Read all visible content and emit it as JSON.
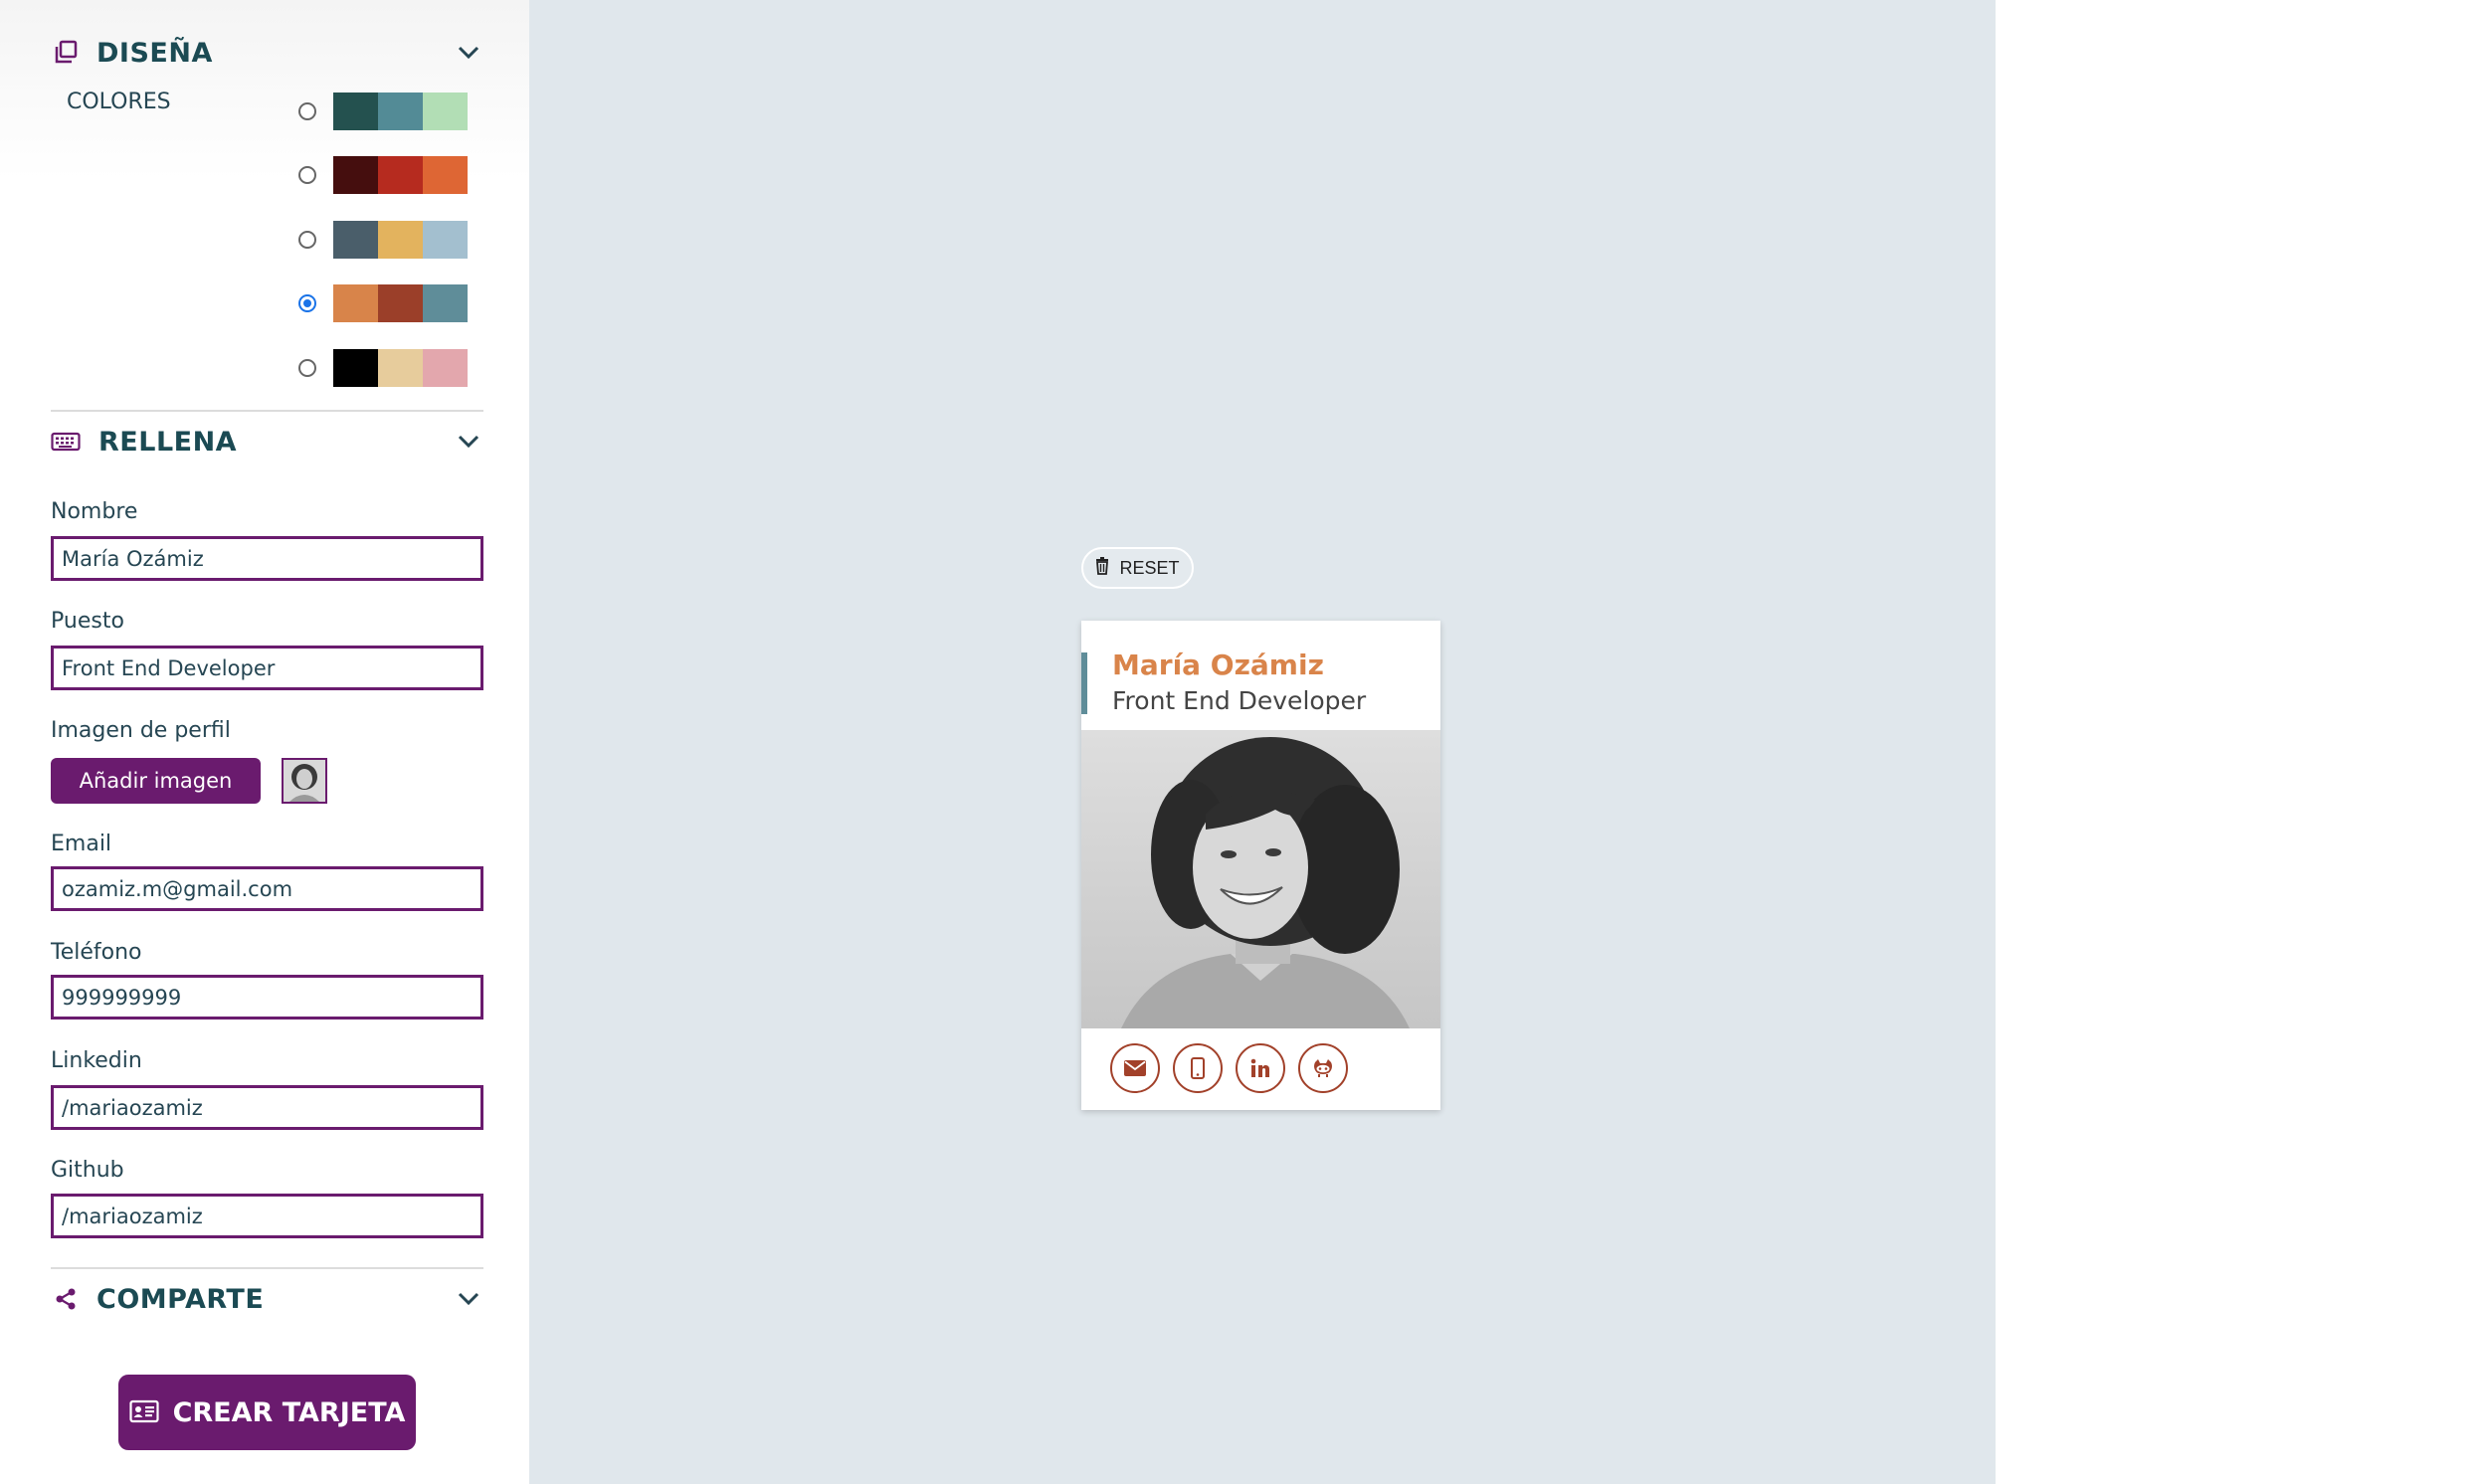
{
  "design": {
    "title": "DISEÑA",
    "colors_label": "COLORES",
    "palettes": [
      {
        "colors": [
          "#24514f",
          "#538b96",
          "#b2deb5"
        ],
        "selected": false
      },
      {
        "colors": [
          "#450e0e",
          "#b62b1f",
          "#de6634"
        ],
        "selected": false
      },
      {
        "colors": [
          "#4a5e6a",
          "#e3b35e",
          "#a3bfcf"
        ],
        "selected": false
      },
      {
        "colors": [
          "#d8844a",
          "#9b3f29",
          "#5f8d99"
        ],
        "selected": true
      },
      {
        "colors": [
          "#000000",
          "#e7cc9c",
          "#e3a7ad"
        ],
        "selected": false
      }
    ]
  },
  "fill": {
    "title": "RELLENA",
    "name_label": "Nombre",
    "name_value": "María Ozámiz",
    "job_label": "Puesto",
    "job_value": "Front End Developer",
    "image_label": "Imagen de perfil",
    "add_image_button": "Añadir imagen",
    "email_label": "Email",
    "email_value": "ozamiz.m@gmail.com",
    "phone_label": "Teléfono",
    "phone_value": "999999999",
    "linkedin_label": "Linkedin",
    "linkedin_value": "/mariaozamiz",
    "github_label": "Github",
    "github_value": "/mariaozamiz"
  },
  "share": {
    "title": "COMPARTE",
    "create_button": "CREAR TARJETA"
  },
  "preview": {
    "reset_label": "RESET",
    "card": {
      "name": "María Ozámiz",
      "job": "Front End Developer",
      "social_icons": [
        "email-icon",
        "mobile-phone-icon",
        "linkedin-icon",
        "github-icon"
      ]
    }
  },
  "colors": {
    "accent_purple": "#6a1b6e",
    "preview_bg": "#e0e7ec",
    "card_name": "#d9844a",
    "card_icon": "#a2412a"
  }
}
